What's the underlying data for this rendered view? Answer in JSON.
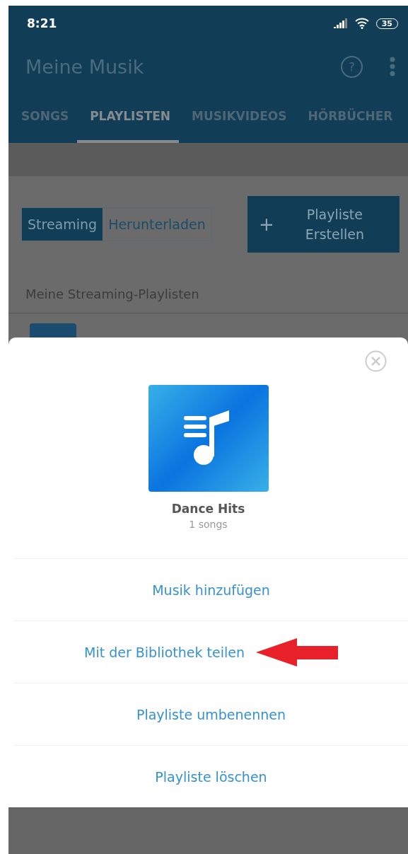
{
  "status_bar": {
    "time": "8:21",
    "battery": "35"
  },
  "app_bar": {
    "title": "Meine Musik",
    "help": "?"
  },
  "tabs": [
    {
      "label": "SONGS",
      "selected": false
    },
    {
      "label": "PLAYLISTEN",
      "selected": true
    },
    {
      "label": "MUSIKVIDEOS",
      "selected": false
    },
    {
      "label": "HÖRBÜCHER",
      "selected": false
    }
  ],
  "segments": [
    {
      "label": "Streaming",
      "selected": true
    },
    {
      "label": "Herunterladen",
      "selected": false
    }
  ],
  "create_button": {
    "icon": "+",
    "label": "Playliste Erstellen"
  },
  "section_title": "Meine Streaming-Playlisten",
  "sheet": {
    "title": "Dance Hits",
    "subtitle": "1 songs",
    "actions": [
      {
        "label": "Musik hinzufügen",
        "annotated": false
      },
      {
        "label": "Mit der Bibliothek teilen",
        "annotated": true
      },
      {
        "label": "Playliste umbenennen",
        "annotated": false
      },
      {
        "label": "Playliste löschen",
        "annotated": false
      }
    ]
  }
}
